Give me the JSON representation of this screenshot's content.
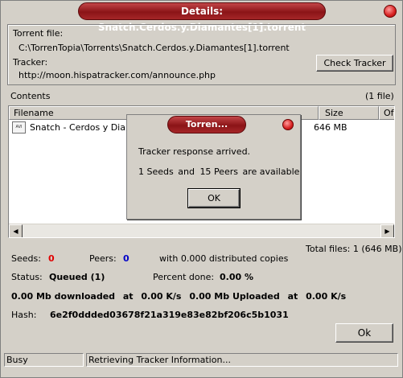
{
  "window": {
    "title": "Details: Snatch.Cerdos.y.Diamantes[1].torrent"
  },
  "info": {
    "torrent_file_label": "Torrent file:",
    "torrent_file_path": "C:\\TorrenTopia\\Torrents\\Snatch.Cerdos.y.Diamantes[1].torrent",
    "tracker_label": "Tracker:",
    "tracker_url": "http://moon.hispatracker.com/announce.php",
    "check_tracker_label": "Check Tracker"
  },
  "contents": {
    "label": "Contents",
    "count": "(1 file)",
    "columns": [
      "Filename",
      "Size",
      "Of"
    ],
    "rows": [
      {
        "filename": "Snatch - Cerdos y Diamar",
        "size": "646 MB"
      }
    ],
    "total": "Total files: 1 (646 MB)"
  },
  "modal": {
    "title": "Torren...",
    "message": "Tracker response arrived.",
    "seeds_count": "1",
    "seeds_word": "Seeds",
    "and1": "and",
    "peers_count": "15",
    "peers_word": "Peers",
    "available": "are available",
    "ok_label": "OK"
  },
  "stats": {
    "seeds_label": "Seeds:",
    "seeds_value": "0",
    "peers_label": "Peers:",
    "peers_value": "0",
    "distributed": "with 0.000 distributed copies",
    "status_label": "Status:",
    "status_value": "Queued (1)",
    "percent_label": "Percent done:",
    "percent_value": "0.00 %",
    "downloaded_value": "0.00 Mb",
    "downloaded_word": "downloaded",
    "at1": "at",
    "down_speed": "0.00 K/s",
    "uploaded_value": "0.00 Mb",
    "uploaded_word": "Uploaded",
    "at2": "at",
    "up_speed": "0.00 K/s",
    "hash_label": "Hash:",
    "hash_value": "6e2f0ddded03678f21a319e83e82bf206c5b1031"
  },
  "ok_button": "Ok",
  "statusbar": {
    "left": "Busy",
    "right": "Retrieving Tracker Information..."
  }
}
